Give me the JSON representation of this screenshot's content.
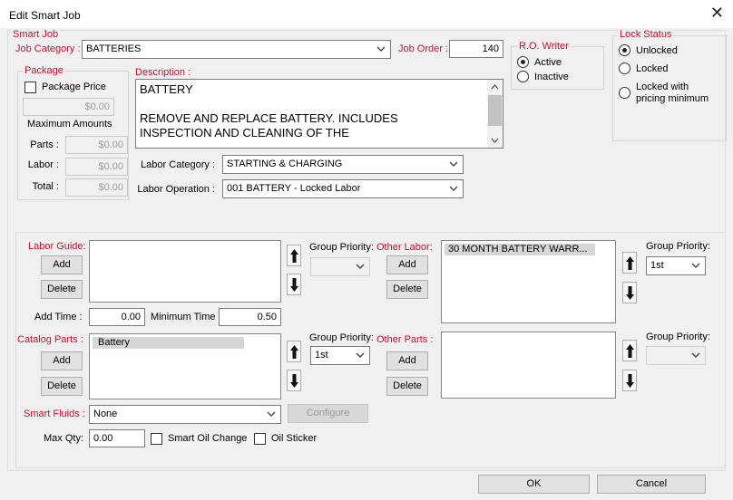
{
  "window": {
    "title": "Edit Smart Job",
    "close_glyph": "✕"
  },
  "smart_job": {
    "legend": "Smart Job",
    "job_category_label": "Job Category :",
    "job_category_value": "BATTERIES",
    "job_order_label": "Job Order :",
    "job_order_value": "140"
  },
  "ro_writer": {
    "legend": "R.O. Writer",
    "active_label": "Active",
    "inactive_label": "Inactive",
    "selected": "Active"
  },
  "lock_status": {
    "legend": "Lock Status",
    "unlocked_label": "Unlocked",
    "locked_label": "Locked",
    "locked_min_label": "Locked with pricing minimum",
    "selected": "Unlocked"
  },
  "package": {
    "legend": "Package",
    "package_price_label": "Package Price",
    "package_price_checked": false,
    "price_value": "$0.00",
    "max_amounts_label": "Maximum Amounts",
    "parts_label": "Parts :",
    "parts_value": "$0.00",
    "labor_label": "Labor :",
    "labor_value": "$0.00",
    "total_label": "Total :",
    "total_value": "$0.00"
  },
  "description": {
    "label": "Description :",
    "line1": "BATTERY",
    "line2": "",
    "line3": "REMOVE AND REPLACE BATTERY. INCLUDES",
    "line4": "INSPECTION AND CLEANING OF THE"
  },
  "labor_category": {
    "label": "Labor Category :",
    "value": "STARTING & CHARGING"
  },
  "labor_operation": {
    "label": "Labor Operation :",
    "value": "001 BATTERY - Locked Labor"
  },
  "labor_guide": {
    "label": "Labor Guide:",
    "add_label": "Add",
    "delete_label": "Delete",
    "group_priority_label": "Group Priority:",
    "group_priority_value": ""
  },
  "other_labor": {
    "label": "Other Labor:",
    "add_label": "Add",
    "delete_label": "Delete",
    "items": [
      "30 MONTH BATTERY WARR..."
    ],
    "group_priority_label": "Group Priority:",
    "group_priority_value": "1st"
  },
  "times": {
    "add_time_label": "Add Time :",
    "add_time_value": "0.00",
    "min_time_label": "Minimum Time :",
    "min_time_value": "0.50"
  },
  "catalog_parts": {
    "label": "Catalog Parts :",
    "add_label": "Add",
    "delete_label": "Delete",
    "items": [
      "Battery"
    ],
    "group_priority_label": "Group Priority:",
    "group_priority_value": "1st"
  },
  "other_parts": {
    "label": "Other Parts :",
    "add_label": "Add",
    "delete_label": "Delete",
    "group_priority_label": "Group Priority:",
    "group_priority_value": ""
  },
  "smart_fluids": {
    "label": "Smart Fluids :",
    "value": "None",
    "configure_label": "Configure"
  },
  "max_qty": {
    "label": "Max Qty:",
    "value": "0.00",
    "smart_oil_change_label": "Smart Oil Change",
    "oil_sticker_label": "Oil Sticker"
  },
  "footer": {
    "ok_label": "OK",
    "cancel_label": "Cancel"
  },
  "icons": {
    "dropdown": "chevron-down-icon",
    "move_up": "arrow-up-icon",
    "move_down": "arrow-down-icon",
    "close": "close-icon"
  }
}
